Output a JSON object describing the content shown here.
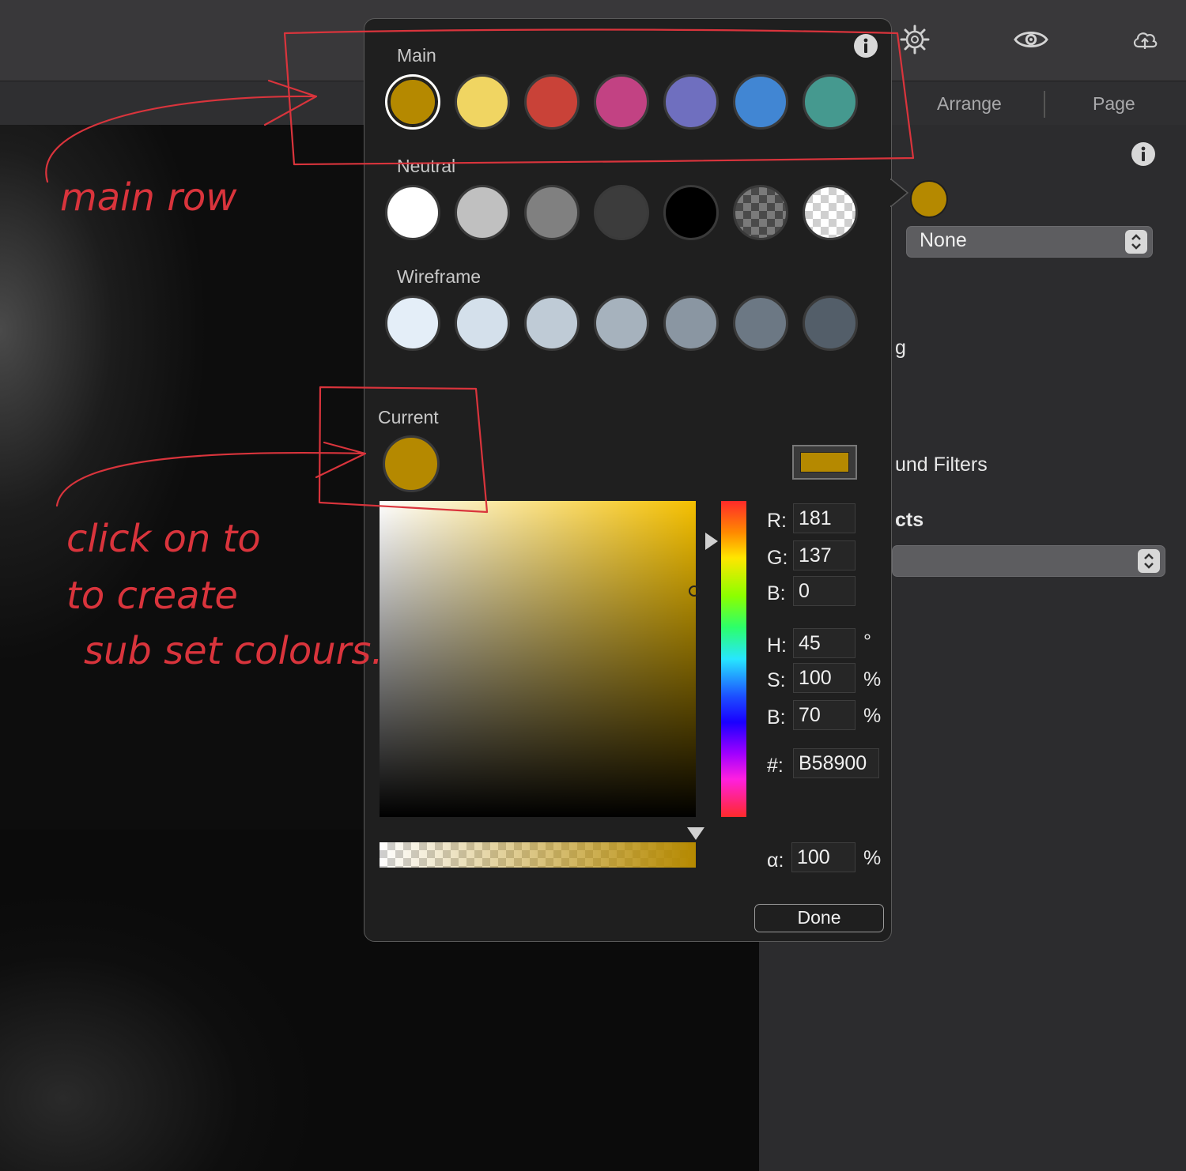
{
  "toolbar": {
    "icons": [
      "gear-icon",
      "eye-icon",
      "cloud-upload-icon"
    ]
  },
  "tabs": [
    {
      "label": "Arrange"
    },
    {
      "label": "Page"
    }
  ],
  "inspector": {
    "border_style_value": "None",
    "partial_label_1": "g",
    "partial_label_2": "und Filters",
    "partial_label_3": "cts",
    "swatch_color": "#b58900"
  },
  "popover": {
    "sections": {
      "main": "Main",
      "neutral": "Neutral",
      "wireframe": "Wireframe",
      "current": "Current"
    },
    "main_colors": [
      "#b58900",
      "#f0d562",
      "#c94238",
      "#c24283",
      "#6f6fbf",
      "#4186d3",
      "#45998f"
    ],
    "neutral_colors": [
      "#ffffff",
      "#c0c0c0",
      "#808080",
      "#3c3c3c",
      "#000000",
      "checker-dark",
      "checker-light"
    ],
    "wireframe_colors": [
      "#e4eef8",
      "#d4e0eb",
      "#bfcbd6",
      "#a6b2bd",
      "#8a96a2",
      "#6c7884",
      "#535e69"
    ],
    "current_color": "#b58900",
    "fields": {
      "r": {
        "label": "R:",
        "value": "181"
      },
      "g": {
        "label": "G:",
        "value": "137"
      },
      "b": {
        "label": "B:",
        "value": "0"
      },
      "h": {
        "label": "H:",
        "value": "45",
        "unit": "°"
      },
      "s": {
        "label": "S:",
        "value": "100",
        "unit": "%"
      },
      "v": {
        "label": "B:",
        "value": "70",
        "unit": "%"
      },
      "hex": {
        "label": "#:",
        "value": "B58900"
      },
      "alpha": {
        "label": "α:",
        "value": "100",
        "unit": "%"
      }
    },
    "done_label": "Done"
  },
  "annotations": {
    "note_1": "main row",
    "note_2_line1": "click on to",
    "note_2_line2": "to create",
    "note_2_line3": "sub set colours.",
    "ink_color": "#d9343c"
  }
}
